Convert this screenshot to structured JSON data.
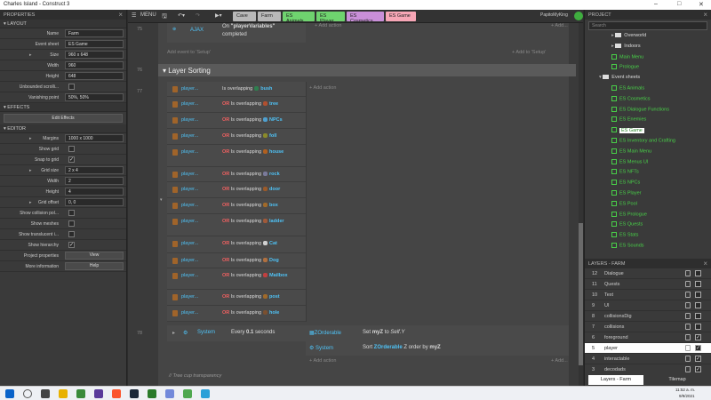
{
  "window": {
    "title": "Charles Island - Construct 3"
  },
  "properties": {
    "header": "PROPERTIES",
    "layout_section": "LAYOUT",
    "layout_rows": [
      {
        "label": "Name",
        "value": "Farm"
      },
      {
        "label": "Event sheet",
        "value": "ES Game"
      },
      {
        "label": "Size",
        "value": "960 x 648"
      },
      {
        "label": "Width",
        "value": "960"
      },
      {
        "label": "Height",
        "value": "648"
      },
      {
        "label": "Unbounded scrolli...",
        "value": ""
      },
      {
        "label": "Vanishing point",
        "value": "50%, 50%"
      }
    ],
    "effects_section": "EFFECTS",
    "edit_effects": "Edit Effects",
    "editor_section": "EDITOR",
    "editor_rows": [
      {
        "label": "Margins",
        "value": "1000 x 1000"
      },
      {
        "label": "Show grid",
        "value": ""
      },
      {
        "label": "Snap to grid",
        "value": "✓"
      },
      {
        "label": "Grid size",
        "value": "2 x 4"
      },
      {
        "label": "Width",
        "value": "2"
      },
      {
        "label": "Height",
        "value": "4"
      },
      {
        "label": "Grid offset",
        "value": "0, 0"
      },
      {
        "label": "Show collision pol...",
        "value": ""
      },
      {
        "label": "Show meshes",
        "value": ""
      },
      {
        "label": "Show translucent i...",
        "value": ""
      },
      {
        "label": "Show hierarchy",
        "value": "✓"
      },
      {
        "label": "Project properties",
        "value": "View"
      },
      {
        "label": "More information",
        "value": "Help"
      }
    ]
  },
  "toolbar": {
    "menu": "MENU",
    "tabs": [
      {
        "label": "Cave",
        "color": "#b8b8b8"
      },
      {
        "label": "Farm",
        "color": "#b8b8b8"
      },
      {
        "label": "ES Animals",
        "color": "#6fd36f"
      },
      {
        "label": "ES Player",
        "color": "#6fd36f"
      },
      {
        "label": "ES Cosmetics",
        "color": "#c98fd8"
      },
      {
        "label": "ES Game",
        "color": "#f7a6b6"
      }
    ],
    "user": "PapitoMyKing"
  },
  "events": {
    "row75_num": "75",
    "ajax_obj": "AJAX",
    "ajax_text_pre": "On ",
    "ajax_arg": "\"playerVariables\"",
    "ajax_text_post": "completed",
    "add_action": "Add action",
    "add_to_setup": "+ Add to 'Setup'",
    "add_event_setup": "Add event to 'Setup'",
    "group_num": "76",
    "group_name": "Layer Sorting",
    "row77_num": "77",
    "conditions": [
      {
        "obj": "player...",
        "or": "",
        "text": "Is overlapping",
        "arg": "bush",
        "icon": "#2f7f4f"
      },
      {
        "obj": "player...",
        "or": "OR",
        "text": "Is overlapping",
        "arg": "tree",
        "icon": "#b05030"
      },
      {
        "obj": "player...",
        "or": "OR",
        "text": "Is overlapping",
        "arg": "NPCs",
        "icon": "#4fa0d0"
      },
      {
        "obj": "player...",
        "or": "OR",
        "text": "Is overlapping",
        "arg": "foll",
        "icon": "#8a8a2a"
      },
      {
        "obj": "player...",
        "or": "OR",
        "text": "Is overlapping",
        "arg": "house",
        "icon": "#b06020"
      },
      {
        "obj": "player...",
        "or": "OR",
        "text": "Is overlapping",
        "arg": "rock",
        "icon": "#7a7a9a"
      },
      {
        "obj": "player...",
        "or": "OR",
        "text": "Is overlapping",
        "arg": "door",
        "icon": "#9a5a2a"
      },
      {
        "obj": "player...",
        "or": "OR",
        "text": "Is overlapping",
        "arg": "box",
        "icon": "#a06a2a"
      },
      {
        "obj": "player...",
        "or": "OR",
        "text": "Is overlapping",
        "arg": "ladder",
        "icon": "#a05a3a"
      },
      {
        "obj": "player...",
        "or": "OR",
        "text": "Is overlapping",
        "arg": "Cat",
        "icon": "#d0d0d0"
      },
      {
        "obj": "player...",
        "or": "OR",
        "text": "Is overlapping",
        "arg": "Dog",
        "icon": "#b07040"
      },
      {
        "obj": "player...",
        "or": "OR",
        "text": "Is overlapping",
        "arg": "Mailbox",
        "icon": "#c04040"
      },
      {
        "obj": "player...",
        "or": "OR",
        "text": "Is overlapping",
        "arg": "post",
        "icon": "#a06a2a"
      },
      {
        "obj": "player...",
        "or": "OR",
        "text": "Is overlapping",
        "arg": "hole",
        "icon": "#7a5030"
      }
    ],
    "row78_num": "78",
    "system_label": "System",
    "every_pre": "Every ",
    "every_val": "0.1",
    "every_post": " seconds",
    "action1_obj": "ZOrderable",
    "action1_text_pre": "Set ",
    "action1_var": "myZ",
    "action1_text_mid": " to ",
    "action1_val": "Self.Y",
    "action2_obj": "System",
    "action2_text_pre": "Sort ",
    "action2_arg": "ZOrderable",
    "action2_text_post": " Z order by ",
    "action2_var": "myZ",
    "comment": "// Tree cup transparency"
  },
  "project": {
    "header": "PROJECT",
    "search_placeholder": "Search",
    "items": [
      {
        "label": "Overworld",
        "kind": "folder",
        "indent": 1
      },
      {
        "label": "Indoors",
        "kind": "folder",
        "indent": 1
      },
      {
        "label": "Main Menu",
        "kind": "layout",
        "indent": 1
      },
      {
        "label": "Prologue",
        "kind": "layout",
        "indent": 1
      },
      {
        "label": "Event sheets",
        "kind": "folder",
        "indent": 0
      },
      {
        "label": "ES Animals",
        "kind": "sheet",
        "indent": 1
      },
      {
        "label": "ES Cosmetics",
        "kind": "sheet",
        "indent": 1
      },
      {
        "label": "ES Dialogue Functions",
        "kind": "sheet",
        "indent": 1
      },
      {
        "label": "ES Enemies",
        "kind": "sheet",
        "indent": 1
      },
      {
        "label": "ES Game",
        "kind": "sheet-selected",
        "indent": 1
      },
      {
        "label": "ES Inventory and Crafting",
        "kind": "sheet",
        "indent": 1
      },
      {
        "label": "ES Main Menu",
        "kind": "sheet",
        "indent": 1
      },
      {
        "label": "ES Menus UI",
        "kind": "sheet",
        "indent": 1
      },
      {
        "label": "ES NFTs",
        "kind": "sheet",
        "indent": 1
      },
      {
        "label": "ES NPCs",
        "kind": "sheet",
        "indent": 1
      },
      {
        "label": "ES Player",
        "kind": "sheet",
        "indent": 1
      },
      {
        "label": "ES Pool",
        "kind": "sheet",
        "indent": 1
      },
      {
        "label": "ES Prologue",
        "kind": "sheet",
        "indent": 1
      },
      {
        "label": "ES Quests",
        "kind": "sheet",
        "indent": 1
      },
      {
        "label": "ES Stats",
        "kind": "sheet",
        "indent": 1
      },
      {
        "label": "ES Sounds",
        "kind": "sheet",
        "indent": 1
      }
    ]
  },
  "layers": {
    "header": "LAYERS - FARM",
    "rows": [
      {
        "n": "12",
        "name": "Dialogue",
        "visible": ""
      },
      {
        "n": "11",
        "name": "Quests",
        "visible": ""
      },
      {
        "n": "10",
        "name": "Text",
        "visible": ""
      },
      {
        "n": "9",
        "name": "UI",
        "visible": ""
      },
      {
        "n": "8",
        "name": "collisionsDig",
        "visible": ""
      },
      {
        "n": "7",
        "name": "collisions",
        "visible": ""
      },
      {
        "n": "6",
        "name": "foreground",
        "visible": "✓"
      },
      {
        "n": "5",
        "name": "player",
        "visible": "✓"
      },
      {
        "n": "4",
        "name": "interactable",
        "visible": "✓"
      },
      {
        "n": "3",
        "name": "decodads",
        "visible": "✓"
      }
    ],
    "tab_layers": "Layers - Farm",
    "tab_tilemap": "Tilemap"
  },
  "taskbar": {
    "time": "11:52 a. m.",
    "date": "9/9/2021"
  }
}
